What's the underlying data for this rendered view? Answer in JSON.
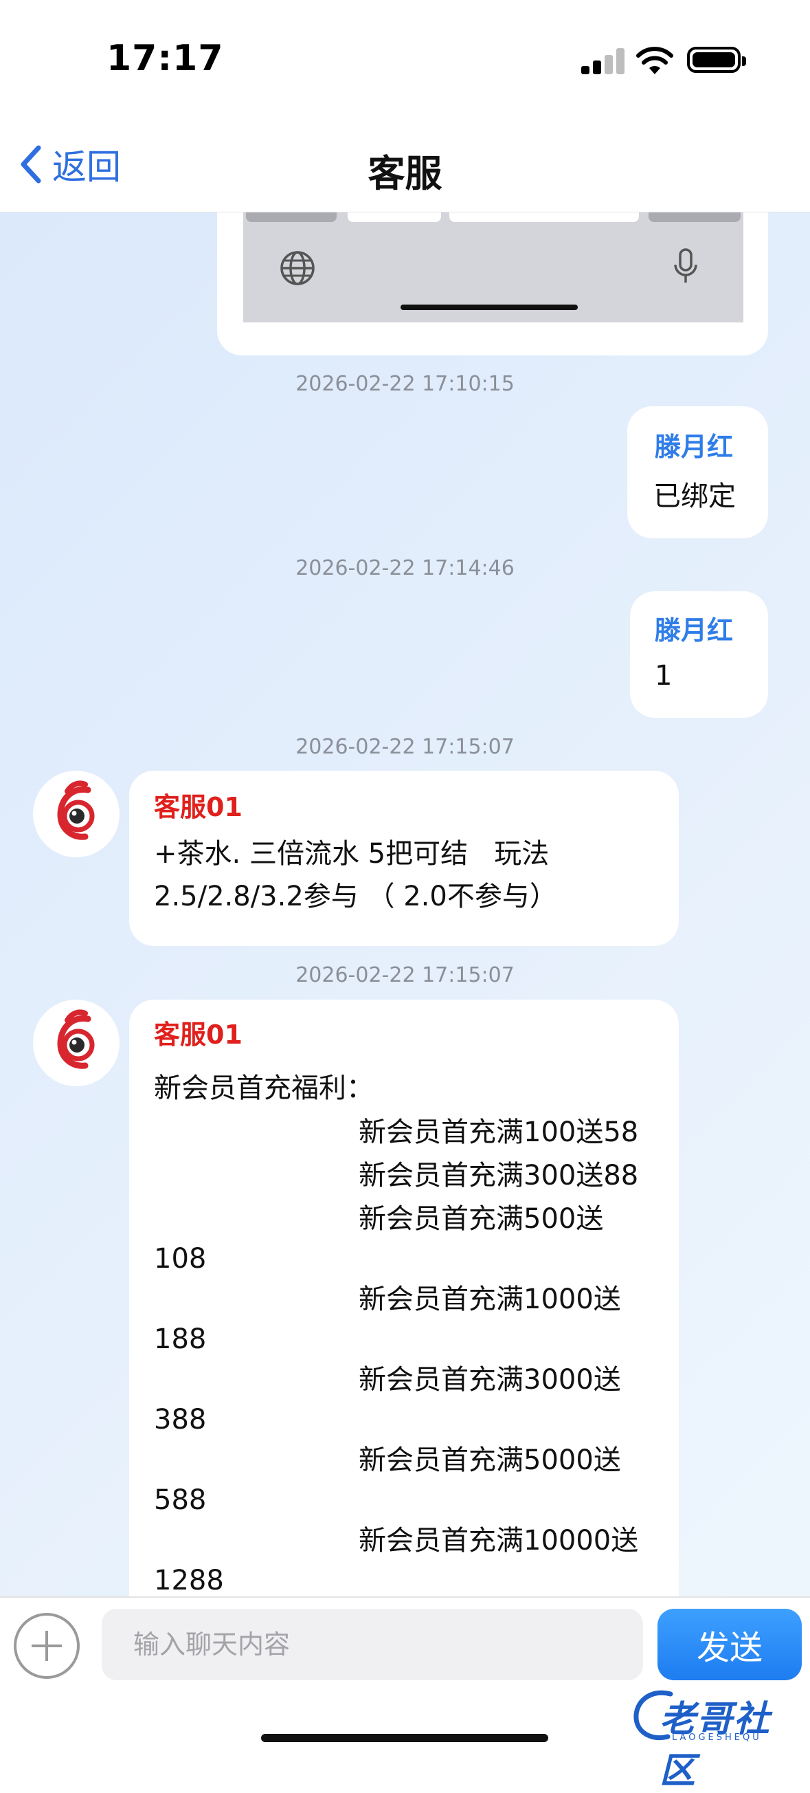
{
  "status_bar": {
    "time": "17:17"
  },
  "nav": {
    "back_label": "返回",
    "title": "客服"
  },
  "messages": [
    {
      "timestamp": "2026-02-22 17:10:15",
      "sender": "滕月红",
      "text": "已绑定"
    },
    {
      "timestamp": "2026-02-22 17:14:46",
      "sender": "滕月红",
      "text": "1"
    },
    {
      "timestamp": "2026-02-22 17:15:07",
      "sender": "客服01",
      "text": "+茶水. 三倍流水 5把可结   玩法\n2.5/2.8/3.2参与 （ 2.0不参与）"
    },
    {
      "timestamp": "2026-02-22 17:15:07",
      "sender": "客服01",
      "lines": [
        "新会员首充福利：",
        "新会员首充满100送58",
        "新会员首充满300送88",
        "新会员首充满500送",
        "108",
        "新会员首充满1000送",
        "188",
        "新会员首充满3000送",
        "388",
        "新会员首充满5000送",
        "588",
        "新会员首充满10000送",
        "1288"
      ]
    }
  ],
  "input": {
    "placeholder": "输入聊天内容",
    "send_label": "发送"
  },
  "watermark": {
    "text": "老哥社区",
    "sub": "LAOGESHEQU"
  },
  "colors": {
    "accent": "#2f6fe0",
    "sender_me": "#2f7de8",
    "sender_cs": "#e0201c",
    "send_button": "#1e7cf0"
  }
}
